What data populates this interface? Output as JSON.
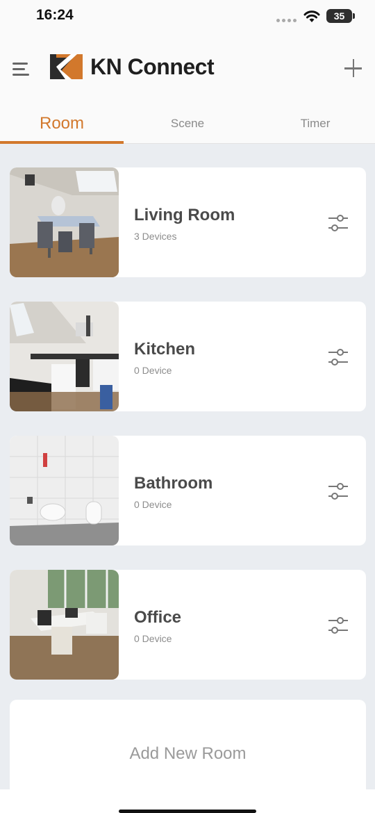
{
  "status_bar": {
    "time": "16:24",
    "battery": "35"
  },
  "app": {
    "title": "KN Connect"
  },
  "tabs": [
    {
      "label": "Room",
      "active": true
    },
    {
      "label": "Scene",
      "active": false
    },
    {
      "label": "Timer",
      "active": false
    }
  ],
  "rooms": [
    {
      "name": "Living Room",
      "devices": "3 Devices"
    },
    {
      "name": "Kitchen",
      "devices": "0 Device"
    },
    {
      "name": "Bathroom",
      "devices": "0 Device"
    },
    {
      "name": "Office",
      "devices": "0 Device"
    }
  ],
  "add_room": {
    "label": "Add New Room"
  },
  "colors": {
    "accent": "#d2782c",
    "background": "#eaedf1",
    "logo_dark": "#2b2b2b"
  },
  "icons": {
    "menu": "hamburger-icon",
    "add": "plus-icon",
    "settings": "sliders-icon",
    "wifi": "wifi-icon",
    "battery": "battery-icon"
  }
}
